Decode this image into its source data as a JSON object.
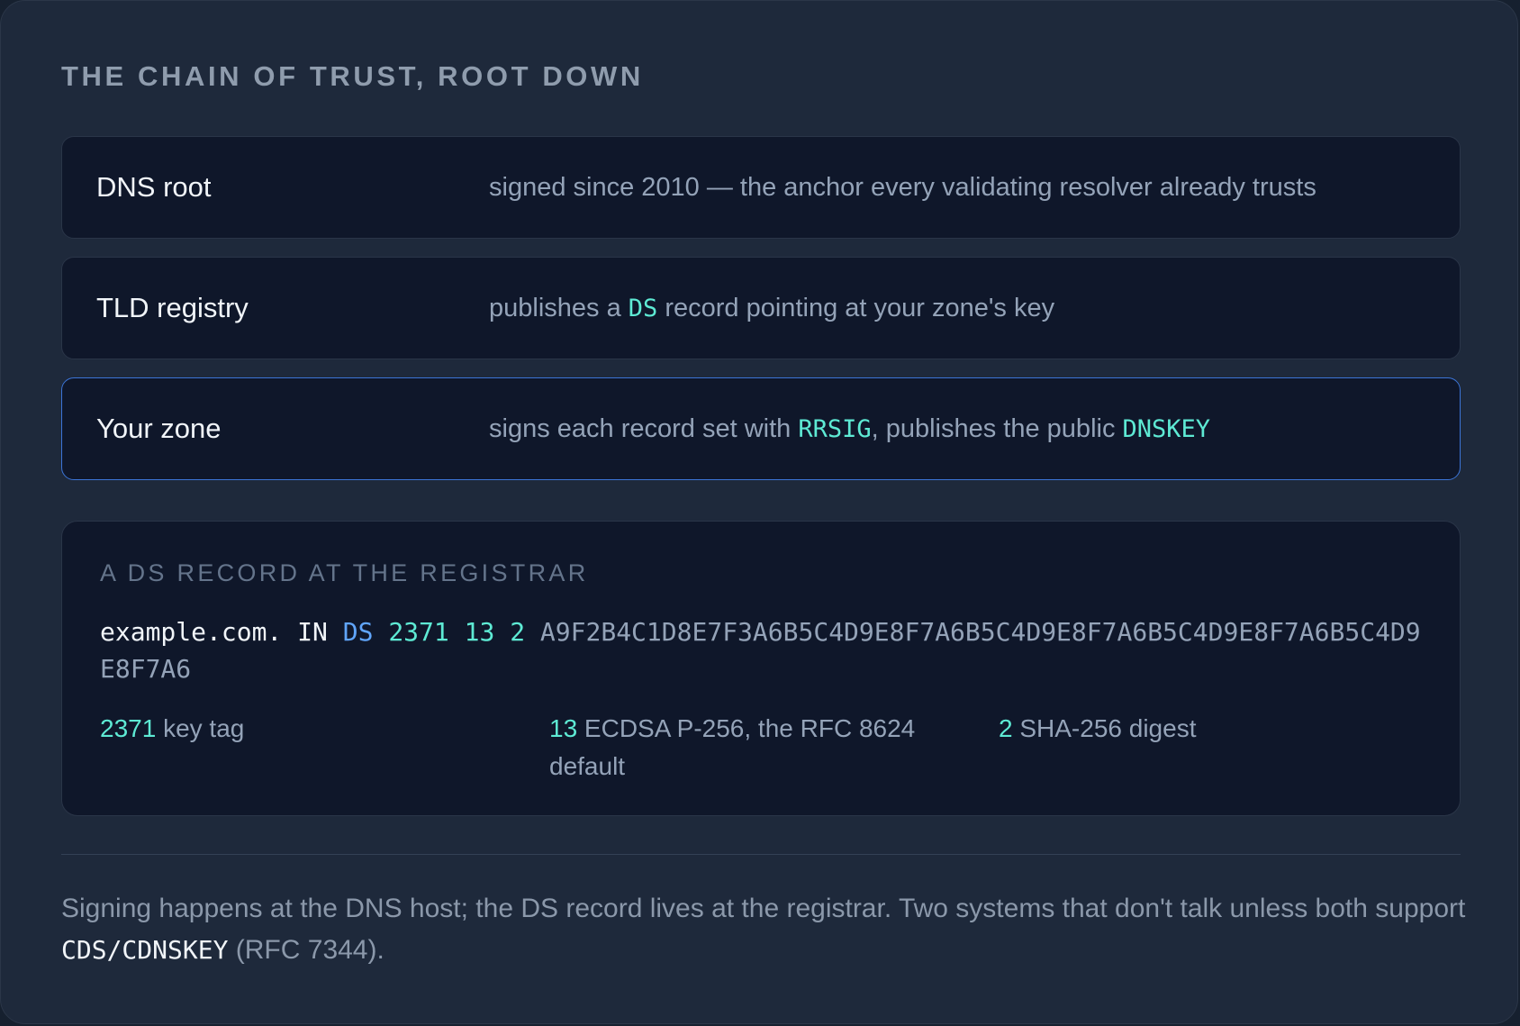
{
  "heading": "THE CHAIN OF TRUST, ROOT DOWN",
  "chain": [
    {
      "name": "DNS root",
      "desc_before": "signed since 2010 — the anchor every validating resolver already trusts",
      "code1": "",
      "desc_middle": "",
      "code2": "",
      "highlighted": false
    },
    {
      "name": "TLD registry",
      "desc_before": "publishes a ",
      "code1": "DS",
      "desc_middle": " record pointing at your zone's key",
      "code2": "",
      "highlighted": false
    },
    {
      "name": "Your zone",
      "desc_before": "signs each record set with ",
      "code1": "RRSIG",
      "desc_middle": ", publishes the public ",
      "code2": "DNSKEY",
      "highlighted": true
    }
  ],
  "ds_panel": {
    "label": "A DS RECORD AT THE REGISTRAR",
    "record": {
      "owner": "example.com.",
      "class": "IN",
      "type": "DS",
      "key_tag": "2371",
      "algorithm": "13",
      "digest_type": "2",
      "digest": "A9F2B4C1D8E7F3A6B5C4D9E8F7A6B5C4D9E8F7A6B5C4D9E8F7A6B5C4D9E8F7A6"
    },
    "legend": [
      {
        "value": "2371",
        "text": " key tag"
      },
      {
        "value": "13",
        "text": " ECDSA P-256, the RFC 8624 default"
      },
      {
        "value": "2",
        "text": " SHA-256 digest"
      }
    ]
  },
  "footnote": {
    "before": "Signing happens at the DNS host; the DS record lives at the registrar. Two systems that don't talk unless both support ",
    "code": "CDS/CDNSKEY",
    "after": " (RFC 7344)."
  },
  "colors": {
    "background": "#1e293b",
    "row_background": "#0f172a",
    "accent_code": "#5eead4",
    "type_blue": "#60a5fa",
    "highlight_border": "#3b74d6"
  }
}
